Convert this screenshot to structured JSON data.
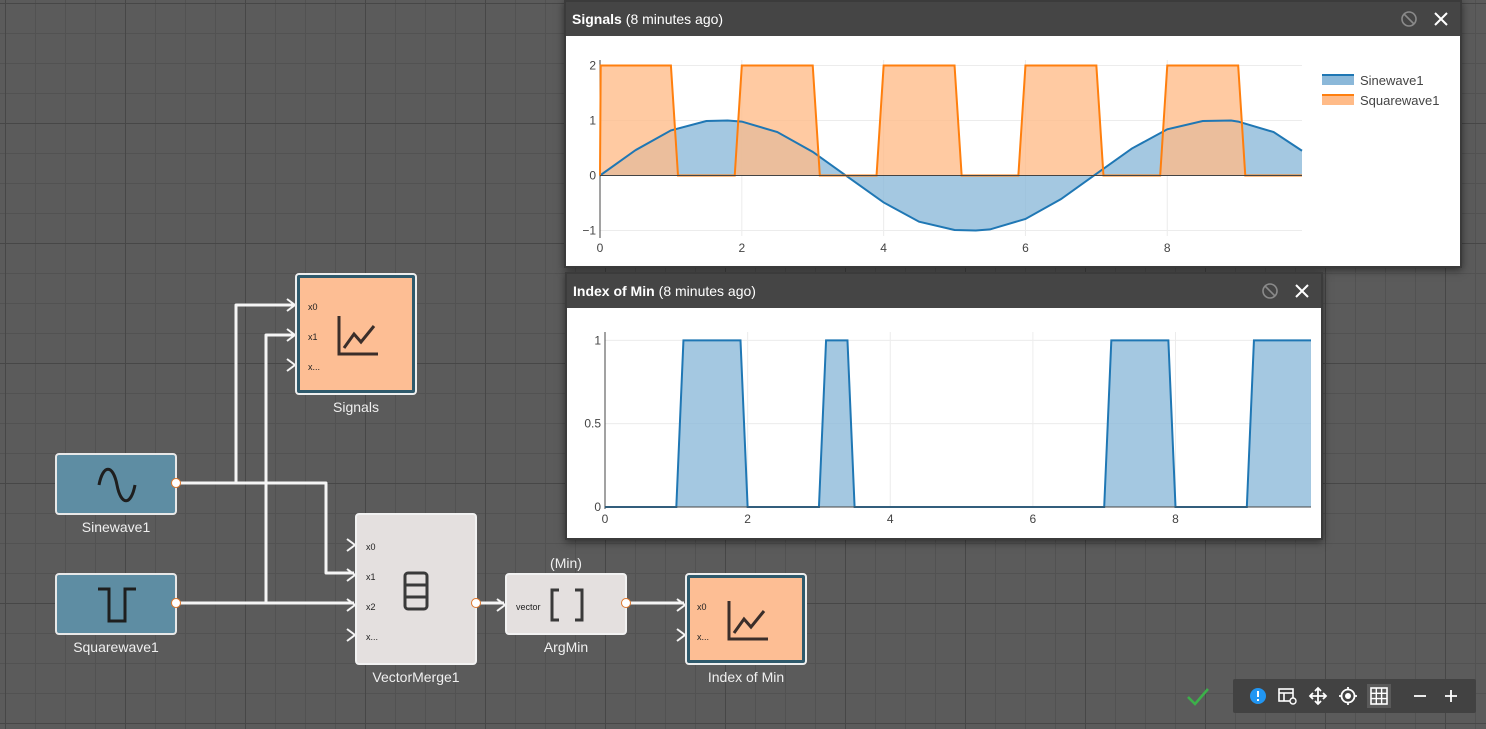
{
  "nodes": {
    "signals": {
      "label": "Signals",
      "ports": [
        "x0",
        "x1",
        "x..."
      ]
    },
    "sinewave": {
      "label": "Sinewave1"
    },
    "squarewave": {
      "label": "Squarewave1"
    },
    "vectormerge": {
      "label": "VectorMerge1",
      "ports": [
        "x0",
        "x1",
        "x2",
        "x..."
      ]
    },
    "argmin": {
      "label": "ArgMin",
      "annotation": "(Min)",
      "port": "vector"
    },
    "index_of_min": {
      "label": "Index of Min",
      "ports": [
        "x0",
        "x..."
      ]
    }
  },
  "panels": {
    "signals": {
      "title": "Signals",
      "ago": "(8 minutes ago)"
    },
    "index_of_min": {
      "title": "Index of Min",
      "ago": "(8 minutes ago)"
    }
  },
  "chart_data": [
    {
      "type": "area",
      "title": "Signals",
      "xlim": [
        0,
        9.9
      ],
      "ylim": [
        -1.1,
        2.1
      ],
      "x_ticks": [
        "0",
        "2",
        "4",
        "6",
        "8"
      ],
      "y_ticks": [
        "−1",
        "0",
        "1",
        "2"
      ],
      "legend_position": "top-right",
      "series": [
        {
          "name": "Sinewave1",
          "color": "#1f77b4",
          "fill": "#8bb8d9",
          "x": [
            0,
            0.5,
            1,
            1.5,
            1.8,
            2,
            2.5,
            3,
            3.5,
            4,
            4.5,
            5,
            5.3,
            5.5,
            6,
            6.5,
            7,
            7.5,
            8,
            8.5,
            8.9,
            9,
            9.5,
            9.9
          ],
          "y": [
            0,
            0.46,
            0.82,
            0.99,
            1,
            0.98,
            0.79,
            0.43,
            -0.03,
            -0.49,
            -0.84,
            -0.99,
            -1,
            -0.98,
            -0.79,
            -0.43,
            0.03,
            0.49,
            0.84,
            0.99,
            1,
            0.98,
            0.79,
            0.45
          ]
        },
        {
          "name": "Squarewave1",
          "color": "#ff7f0e",
          "fill": "#ffbb88",
          "x": [
            0,
            0.01,
            1,
            1.1,
            1.9,
            2,
            3,
            3.1,
            3.9,
            4,
            5,
            5.1,
            5.9,
            6,
            7,
            7.1,
            7.9,
            8,
            9,
            9.1,
            9.9
          ],
          "y": [
            0,
            2,
            2,
            0,
            0,
            2,
            2,
            0,
            0,
            2,
            2,
            0,
            0,
            2,
            2,
            0,
            0,
            2,
            2,
            0,
            0
          ]
        }
      ]
    },
    {
      "type": "area",
      "title": "Index of Min",
      "xlim": [
        0,
        9.9
      ],
      "ylim": [
        0,
        1.05
      ],
      "x_ticks": [
        "0",
        "2",
        "4",
        "6",
        "8"
      ],
      "y_ticks": [
        "0",
        "0.5",
        "1"
      ],
      "series": [
        {
          "color": "#1f77b4",
          "fill": "#8bb8d9",
          "x": [
            0,
            1,
            1.1,
            1.9,
            2,
            3,
            3.1,
            3.4,
            3.5,
            7,
            7.1,
            7.9,
            8,
            9,
            9.1,
            9.9
          ],
          "y": [
            0,
            0,
            1,
            1,
            0,
            0,
            1,
            1,
            0,
            0,
            1,
            1,
            0,
            0,
            1,
            1
          ]
        }
      ]
    }
  ],
  "toolbar": {
    "status": "check-icon",
    "buttons": [
      "info-icon",
      "table-view-icon",
      "move-icon",
      "center-icon",
      "grid-icon",
      "zoom-out-icon",
      "zoom-in-icon"
    ]
  },
  "colors": {
    "wire": "#f5f5f5",
    "source_block": "#5e8da3",
    "plot_block": "#fdbe94",
    "process_block": "#e4e0df",
    "port_border": "#e0772a"
  }
}
